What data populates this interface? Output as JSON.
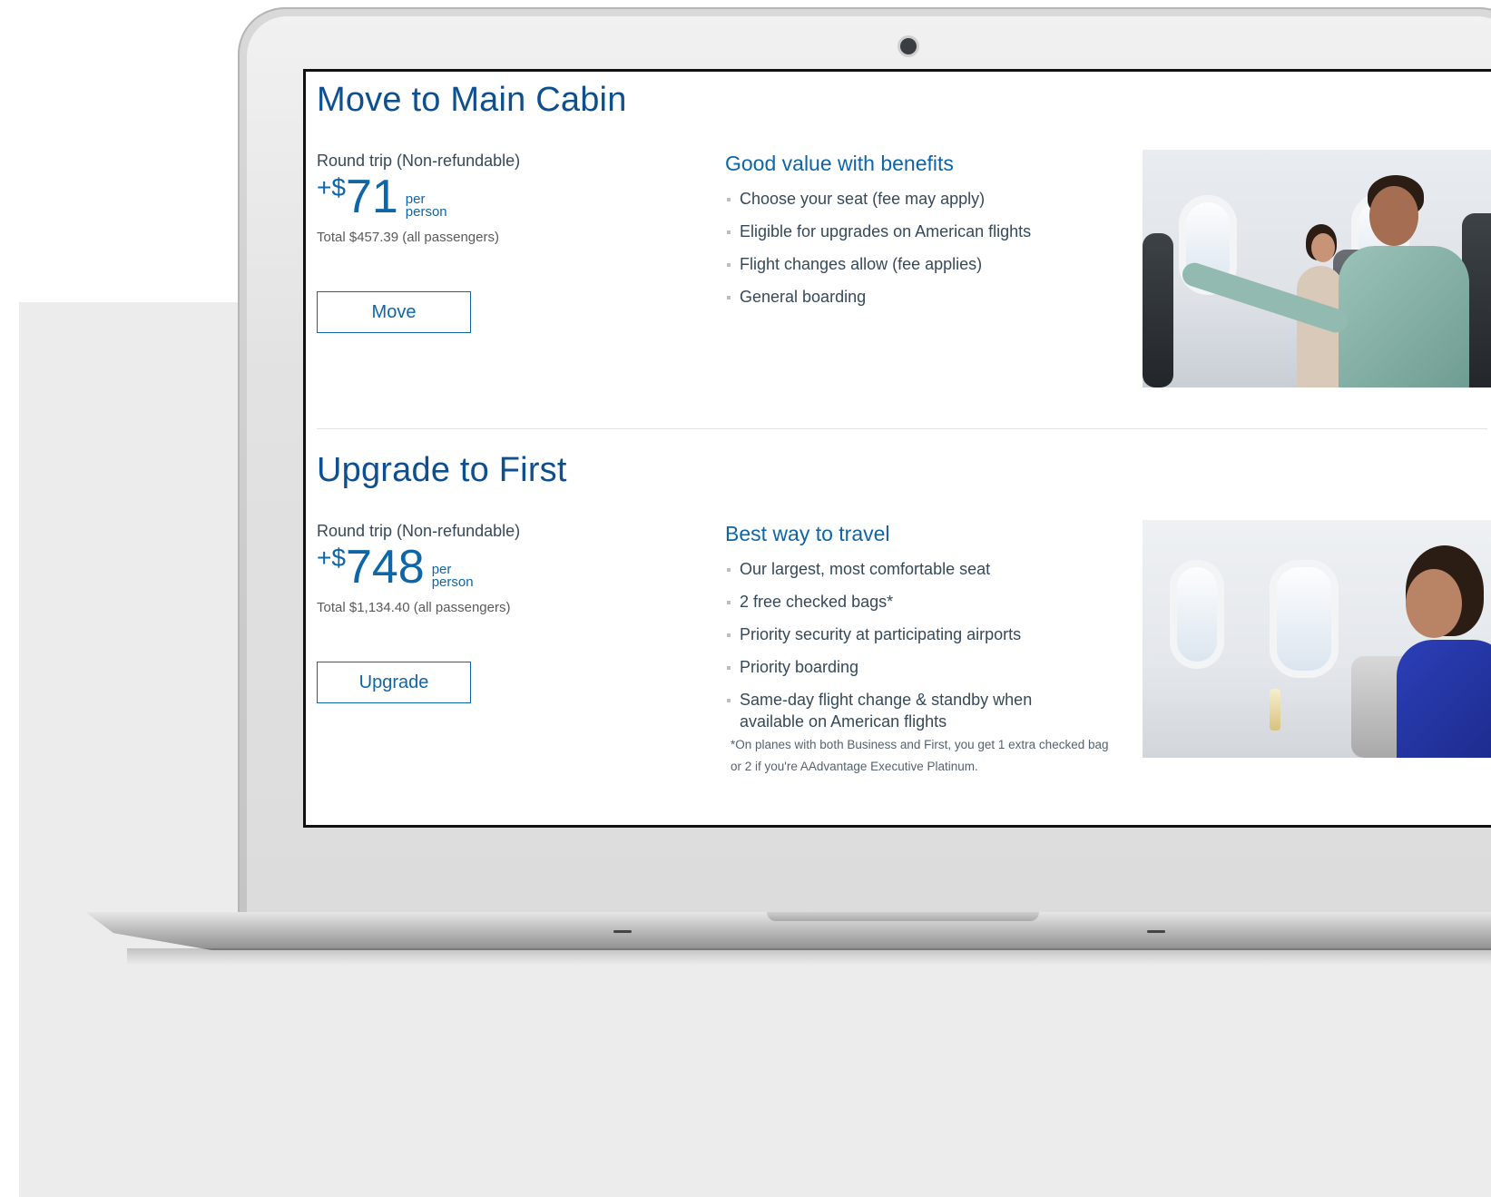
{
  "offers": [
    {
      "title": "Move to Main Cabin",
      "trip_type": "Round trip (Non-refundable)",
      "price_prefix": "+$",
      "price_amount": "71",
      "price_per_line1": "per",
      "price_per_line2": "person",
      "total": "Total $457.39 (all passengers)",
      "button_label": "Move",
      "benefits_title": "Good value with benefits",
      "benefits": [
        "Choose your seat (fee may apply)",
        "Eligible for upgrades on American flights",
        "Flight changes allow (fee applies)",
        "General boarding"
      ]
    },
    {
      "title": "Upgrade to First",
      "trip_type": "Round trip (Non-refundable)",
      "price_prefix": "+$",
      "price_amount": "748",
      "price_per_line1": "per",
      "price_per_line2": "person",
      "total": "Total $1,134.40 (all passengers)",
      "button_label": "Upgrade",
      "benefits_title": "Best way to travel",
      "benefits": [
        "Our largest, most comfortable seat",
        "2 free checked bags*",
        "Priority security at participating airports",
        "Priority boarding",
        "Same-day flight change & standby when available on American flights"
      ],
      "footnote": "*On planes with both Business and First, you get 1 extra checked bag or 2 if you're AAdvantage Executive Platinum."
    }
  ],
  "colors": {
    "accent": "#0e65a8",
    "title": "#0e4f8f",
    "body_text": "#36495a"
  }
}
